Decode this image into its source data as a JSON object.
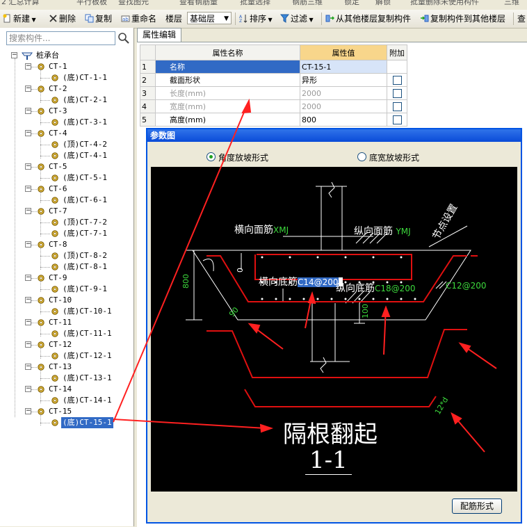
{
  "top_strip": [
    "2 汇总计算",
    "平行板板",
    "查找图元",
    "查看钢筋量",
    "批量选择",
    "钢筋三维",
    "锁定",
    "解锁",
    "批量删除未使用构件",
    "三维"
  ],
  "toolbar": {
    "new_label": "新建",
    "delete_label": "删除",
    "copy_label": "复制",
    "rename_label": "重命名",
    "floor_label": "楼层",
    "floor_value": "基础层",
    "sort_label": "排序",
    "filter_label": "过滤",
    "copy_from_label": "从其他楼层复制构件",
    "copy_to_label": "复制构件到其他楼层",
    "check_label": "查"
  },
  "search": {
    "placeholder": "搜索构件..."
  },
  "tree": {
    "root": "桩承台",
    "groups": [
      {
        "name": "CT-1",
        "children": [
          "(底)CT-1-1"
        ]
      },
      {
        "name": "CT-2",
        "children": [
          "(底)CT-2-1"
        ]
      },
      {
        "name": "CT-3",
        "children": [
          "(底)CT-3-1"
        ]
      },
      {
        "name": "CT-4",
        "children": [
          "(顶)CT-4-2",
          "(底)CT-4-1"
        ]
      },
      {
        "name": "CT-5",
        "children": [
          "(底)CT-5-1"
        ]
      },
      {
        "name": "CT-6",
        "children": [
          "(底)CT-6-1"
        ]
      },
      {
        "name": "CT-7",
        "children": [
          "(顶)CT-7-2",
          "(底)CT-7-1"
        ]
      },
      {
        "name": "CT-8",
        "children": [
          "(顶)CT-8-2",
          "(底)CT-8-1"
        ]
      },
      {
        "name": "CT-9",
        "children": [
          "(底)CT-9-1"
        ]
      },
      {
        "name": "CT-10",
        "children": [
          "(底)CT-10-1"
        ]
      },
      {
        "name": "CT-11",
        "children": [
          "(底)CT-11-1"
        ]
      },
      {
        "name": "CT-12",
        "children": [
          "(底)CT-12-1"
        ]
      },
      {
        "name": "CT-13",
        "children": [
          "(底)CT-13-1"
        ]
      },
      {
        "name": "CT-14",
        "children": [
          "(底)CT-14-1"
        ]
      },
      {
        "name": "CT-15",
        "children": [
          "(底)CT-15-1"
        ]
      }
    ],
    "selected": "(底)CT-15-1"
  },
  "property_tab": "属性编辑",
  "grid": {
    "headers": [
      "属性名称",
      "属性值",
      "附加"
    ],
    "rows": [
      {
        "num": "1",
        "name": "名称",
        "value": "CT-15-1",
        "checkbox": false
      },
      {
        "num": "2",
        "name": "截面形状",
        "value": "异形",
        "checkbox": true
      },
      {
        "num": "3",
        "name": "长度(mm)",
        "value": "2000",
        "checkbox": true
      },
      {
        "num": "4",
        "name": "宽度(mm)",
        "value": "2000",
        "checkbox": true
      },
      {
        "num": "5",
        "name": "高度(mm)",
        "value": "800",
        "checkbox": true
      }
    ]
  },
  "dialog": {
    "title": "参数图",
    "radio_angle": "角度放坡形式",
    "radio_width": "底宽放坡形式",
    "radio_selected": "angle",
    "button_label": "配筋形式"
  },
  "diagram": {
    "label_top_bar": "横向面筋",
    "label_top_bar_code": "XMJ",
    "label_long_top": "纵向面筋",
    "label_long_top_code": "YMJ",
    "label_node": "节点设置",
    "label_bottom_bar": "横向底筋",
    "label_bottom_bar_value": "C14@200",
    "label_long_bottom": "纵向底筋",
    "label_long_bottom_value": "C18@200",
    "label_side_value": "C12@200",
    "dim_height": "800",
    "dim_top": "0",
    "dim_angle": "90",
    "dim_bottom": "100",
    "dim_hook": "12*d",
    "big_text": "隔根翻起",
    "section_label": "1-1"
  },
  "colors": {
    "selection": "#316ac5",
    "header_highlight": "#f8d68b",
    "rebar_red": "#e01010",
    "label_green": "#3cd83c",
    "title_bar": "#0a4bd8"
  }
}
